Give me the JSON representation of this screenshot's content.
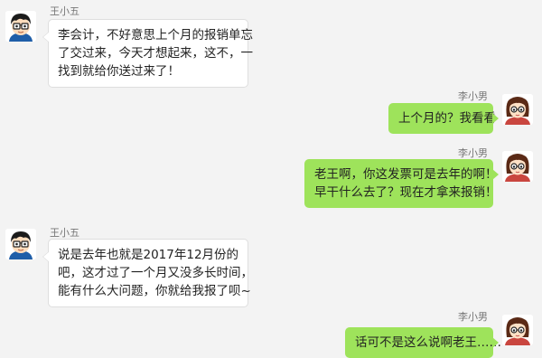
{
  "chat": {
    "messages": [
      {
        "sender": "王小五",
        "side": "left",
        "avatar_icon": "boy-avatar-icon",
        "lines": [
          "李会计，不好意思上个月的报销单忘",
          "了交过来，今天才想起来，这不，一",
          "找到就给你送过来了！"
        ]
      },
      {
        "sender": "李小男",
        "side": "right",
        "avatar_icon": "girl-glasses-avatar-icon",
        "lines": [
          "上个月的？我看看"
        ]
      },
      {
        "sender": "李小男",
        "side": "right",
        "avatar_icon": "girl-glasses-avatar-icon",
        "lines": [
          "老王啊，你这发票可是去年的啊！",
          "早干什么去了？现在才拿来报销！"
        ]
      },
      {
        "sender": "王小五",
        "side": "left",
        "avatar_icon": "boy-avatar-icon",
        "lines": [
          "说是去年也就是2017年12月份的",
          "吧，这才过了一个月又没多长时间，",
          "能有什么大问题，你就给我报了呗~"
        ]
      },
      {
        "sender": "李小男",
        "side": "right",
        "avatar_icon": "girl-glasses-avatar-icon",
        "lines": [
          "话可不是这么说啊老王……"
        ]
      }
    ]
  },
  "colors": {
    "background": "#f3f3f3",
    "left_bubble": "#ffffff",
    "right_bubble": "#9ee35b",
    "sender_name": "#777777"
  }
}
